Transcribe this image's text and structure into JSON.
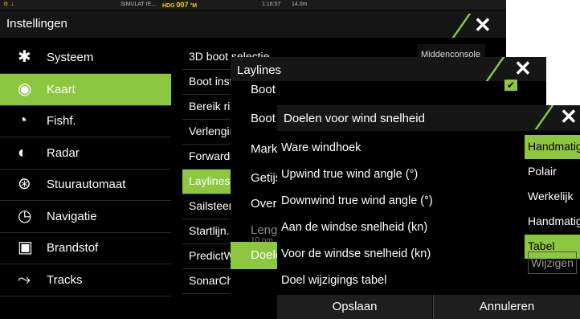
{
  "status": {
    "left": "SIMULAT IE...",
    "hdg_label": "HDG",
    "hdg_value": "007",
    "hdg_unit": "°M",
    "time": "1:16:57",
    "range": "14.0m"
  },
  "settings": {
    "title": "Instellingen",
    "sidebar": [
      {
        "label": "Systeem",
        "icon": "gear-icon"
      },
      {
        "label": "Kaart",
        "icon": "chart-icon"
      },
      {
        "label": "Fishf.",
        "icon": "fish-icon"
      },
      {
        "label": "Radar",
        "icon": "radar-icon"
      },
      {
        "label": "Stuurautomaat",
        "icon": "autopilot-icon"
      },
      {
        "label": "Navigatie",
        "icon": "compass-icon"
      },
      {
        "label": "Brandstof",
        "icon": "fuel-icon"
      },
      {
        "label": "Tracks",
        "icon": "tracks-icon"
      }
    ],
    "middle": [
      "3D boot selectie",
      "Boot inst",
      "Bereik ri",
      "Verlengir",
      "ForwardS",
      "Laylines",
      "Sailsteer",
      "Startlijn.",
      "PredictW",
      "SonarCha"
    ],
    "boat_select_value": "Middenconsole"
  },
  "laylines": {
    "title": "Laylines",
    "rows": [
      "Boot",
      "Boot l",
      "Marke",
      "Getijs",
      "Overl",
      "Lengt",
      "Doele"
    ],
    "length_sub": "10 nm"
  },
  "doelen": {
    "title": "Doelen voor wind snelheid",
    "rows": [
      "Ware windhoek",
      "Upwind true wind angle (°)",
      "Downwind true wind angle (°)",
      "Aan de windse snelheid (kn)",
      "Voor de windse snelheid (kn)",
      "Doel wijzigings tabel"
    ],
    "options": [
      "Handmatig",
      "Polair",
      "Werkelijk",
      "Handmatig",
      "Tabel"
    ],
    "edit_button": "Wijzigen",
    "save_button": "Opslaan",
    "cancel_button": "Annuleren"
  },
  "colors": {
    "accent": "#8dc63f",
    "background": "#000000"
  }
}
